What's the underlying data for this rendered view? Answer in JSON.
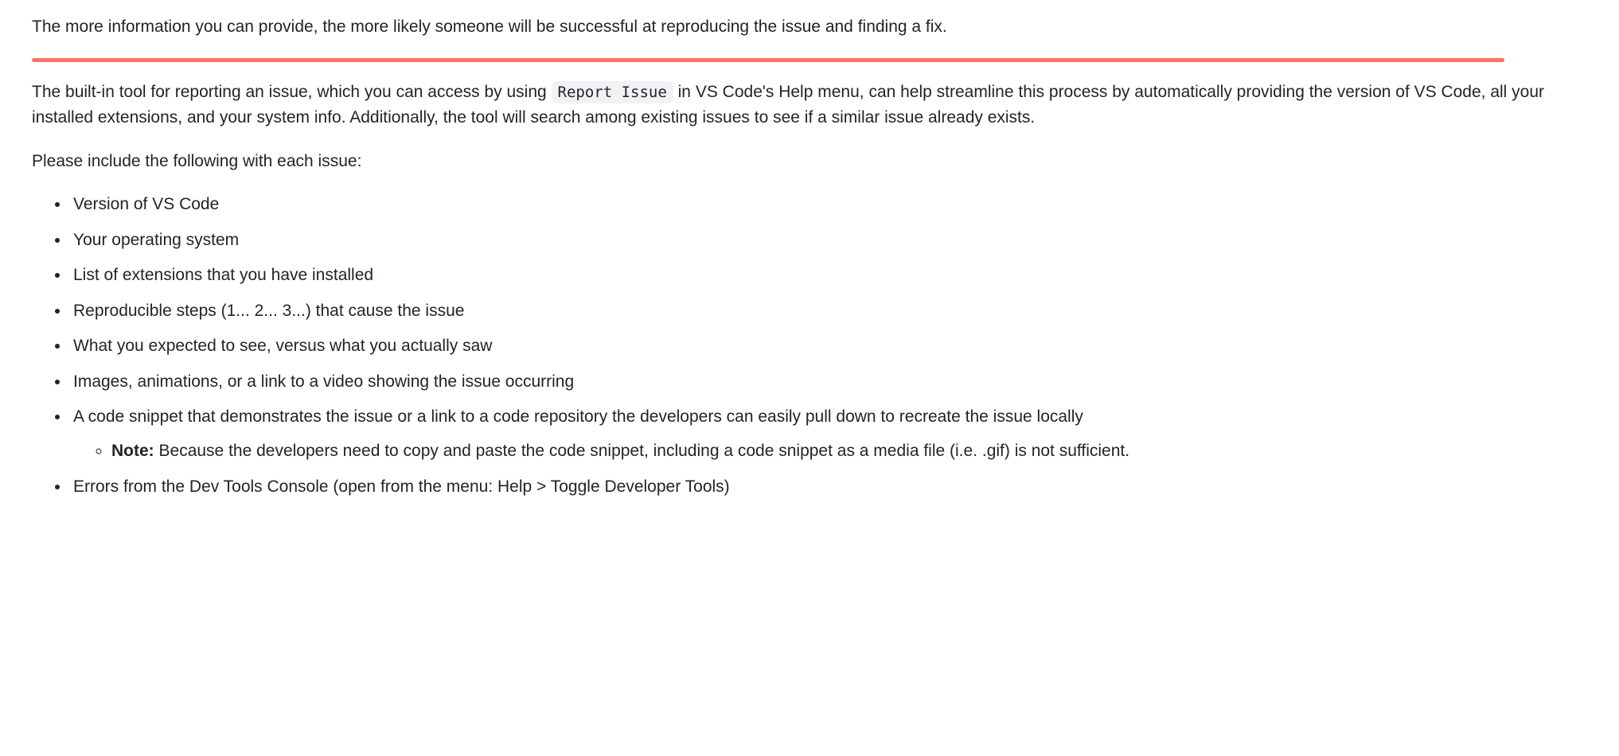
{
  "intro": "The more information you can provide, the more likely someone will be successful at reproducing the issue and finding a fix.",
  "para2_pre": "The built-in tool for reporting an issue, which you can access by using ",
  "para2_code": "Report Issue",
  "para2_post": " in VS Code's Help menu, can help streamline this process by automatically providing the version of VS Code, all your installed extensions, and your system info. Additionally, the tool will search among existing issues to see if a similar issue already exists.",
  "include_heading": "Please include the following with each issue:",
  "items": {
    "i0": "Version of VS Code",
    "i1": "Your operating system",
    "i2": "List of extensions that you have installed",
    "i3": "Reproducible steps (1... 2... 3...) that cause the issue",
    "i4": "What you expected to see, versus what you actually saw",
    "i5": "Images, animations, or a link to a video showing the issue occurring",
    "i6": "A code snippet that demonstrates the issue or a link to a code repository the developers can easily pull down to recreate the issue locally",
    "i7": "Errors from the Dev Tools Console (open from the menu: Help > Toggle Developer Tools)"
  },
  "note_label": "Note:",
  "note_text": " Because the developers need to copy and paste the code snippet, including a code snippet as a media file (i.e. .gif) is not sufficient."
}
